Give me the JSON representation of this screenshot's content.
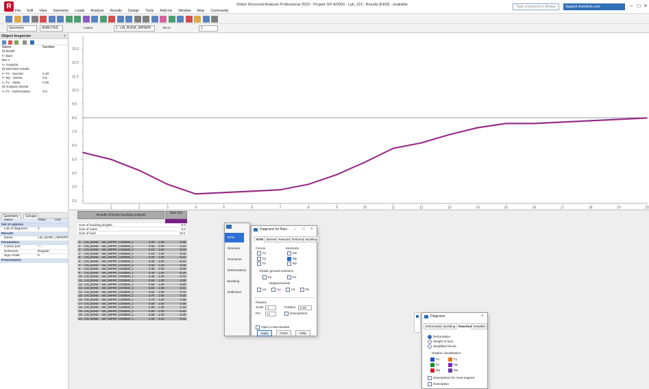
{
  "app": {
    "title": "Robot Structural Analysis Professional 2023 - Projekt: KP-ED500 - Lyk_123 - Results [FEM] - available",
    "logo_letter": "R",
    "search_placeholder": "Type a keyword or phrase",
    "account_label": "Support.Autodesk.com",
    "window_controls": [
      "–",
      "□",
      "×"
    ]
  },
  "menu": [
    "File",
    "Edit",
    "View",
    "Geometry",
    "Loads",
    "Analysis",
    "Results",
    "Design",
    "Tools",
    "Add-Ins",
    "Window",
    "Help",
    "Community"
  ],
  "toolbar": {
    "structure_type_label": "ANALYSIS",
    "layout_select": "Geometry",
    "case_label": "Cases",
    "cases_select": "1: LIN_BUNK_IMPERF",
    "unit_label": "kN·m",
    "extra_select": "1"
  },
  "navigator": {
    "title": "Object Inspector",
    "close_glyph": "×",
    "columns": [
      "Name",
      "Number"
    ],
    "tree": [
      {
        "label": "⊟ Model",
        "value": ""
      },
      {
        "label": "   ⊢ Bars",
        "value": ""
      },
      {
        "label": "      Bar 1",
        "value": ""
      },
      {
        "label": "   ⊢ Analysis",
        "value": ""
      },
      {
        "label": "⊟ Selected results",
        "value": ""
      },
      {
        "label": "   ⊢ Fz - Section",
        "value": "0.40"
      },
      {
        "label": "   ⊢ My - Stress",
        "value": "0.5"
      },
      {
        "label": "   ⊢ Fx - Table",
        "value": "0.00"
      },
      {
        "label": "⊟ Analysis sheets",
        "value": ""
      },
      {
        "label": "   ⊢ Fz - Deformation",
        "value": "0.0"
      }
    ]
  },
  "properties": {
    "tabs": [
      "Geometry",
      "Groups"
    ],
    "columns": [
      "Name",
      "Value",
      "Unit"
    ],
    "groups": [
      {
        "header": "Set of options",
        "rows": [
          {
            "name": "List of diagrams",
            "value": "1"
          }
        ]
      },
      {
        "header": "Results",
        "rows": [
          {
            "name": "Name",
            "value": "LIN_BUNK_IMPERF"
          }
        ]
      },
      {
        "header": "Parameters",
        "rows": [
          {
            "name": "Cursor pos.",
            "value": "—"
          },
          {
            "name": "Extremes",
            "value": "Regular"
          },
          {
            "name": "Sign mode",
            "value": "0"
          }
        ]
      },
      {
        "header": "Presentation",
        "rows": []
      }
    ]
  },
  "chart_data": {
    "type": "line",
    "xlabel": "",
    "ylabel": "",
    "x_ticks": [
      "1",
      "2",
      "3",
      "4",
      "5",
      "6",
      "7",
      "8",
      "9",
      "10",
      "11",
      "12",
      "13",
      "14",
      "15",
      "16",
      "17",
      "18",
      "19",
      "20"
    ],
    "y_ticks": [
      "2.0",
      "3.0",
      "4.0",
      "5.0",
      "6.0",
      "7.0",
      "8.0",
      "9.0",
      "10.0",
      "11.0",
      "12.0",
      "13.0"
    ],
    "xlim": [
      0,
      20
    ],
    "ylim": [
      1.8,
      13.9
    ],
    "reference_line": 8.0,
    "grid": false,
    "series": [
      {
        "x": [
          0,
          1,
          2,
          3,
          4,
          5,
          6,
          7,
          8,
          9,
          10,
          11,
          12,
          13,
          14,
          15,
          16,
          17,
          18,
          19,
          20
        ],
        "values": [
          5.5,
          5.0,
          4.2,
          3.2,
          2.5,
          2.6,
          2.7,
          2.8,
          3.2,
          3.9,
          4.8,
          5.8,
          6.2,
          6.8,
          7.3,
          7.6,
          7.6,
          7.7,
          7.8,
          7.9,
          8.0
        ],
        "color": "#6a2584"
      },
      {
        "x": [
          0,
          1,
          2,
          3,
          4,
          5,
          6,
          7,
          8,
          9,
          10,
          11,
          12,
          13,
          14,
          15,
          16,
          17,
          18,
          19,
          20
        ],
        "values": [
          5.45,
          4.95,
          4.15,
          3.15,
          2.45,
          2.55,
          2.65,
          2.75,
          3.15,
          3.85,
          4.75,
          5.75,
          6.15,
          6.75,
          7.25,
          7.55,
          7.55,
          7.65,
          7.75,
          7.85,
          7.95
        ],
        "color": "#d23a8c"
      }
    ]
  },
  "results_table": {
    "title": "Results of linear buckling analysis",
    "value_header": "Max (m)",
    "accent_color": "#7a1f86",
    "summary": [
      {
        "label": "Sum of buckling lengths",
        "value": "0.0"
      },
      {
        "label": "Sum of mass",
        "value": "0.0"
      },
      {
        "label": "Sum of load",
        "value": "-15.1"
      }
    ],
    "rows": [
      [
        "1",
        "LIN_BUNK",
        "BK_IMPRF_COMBIN_1",
        "0.00",
        "1.00",
        "-2.08"
      ],
      [
        "2",
        "LIN_BUNK",
        "BK_IMPRF_COMBIN_1",
        "0.05",
        "1.00",
        "-4.34"
      ],
      [
        "3",
        "LIN_BUNK",
        "BK_IMPRF_COMBIN_1",
        "0.10",
        "1.00",
        "-5.18"
      ],
      [
        "4",
        "LIN_BUNK",
        "BK_IMPRF_COMBIN_1",
        "0.15",
        "1.00",
        "-6.02"
      ],
      [
        "5",
        "LIN_BUNK",
        "BK_IMPRF_COMBIN_1",
        "0.20",
        "1.00",
        "-6.41"
      ],
      [
        "6",
        "LIN_BUNK",
        "BK_IMPRF_COMBIN_1",
        "0.25",
        "1.00",
        "-6.16"
      ],
      [
        "7",
        "LIN_BUNK",
        "BK_IMPRF_COMBIN_1",
        "0.30",
        "1.00",
        "-5.95"
      ],
      [
        "8",
        "LIN_BUNK",
        "BK_IMPRF_COMBIN_1",
        "0.35",
        "1.00",
        "-5.69"
      ],
      [
        "9",
        "LIN_BUNK",
        "BK_IMPRF_COMBIN_1",
        "0.40",
        "1.00",
        "-5.18"
      ],
      [
        "10",
        "LIN_BUNK",
        "BK_IMPRF_COMBIN_1",
        "0.45",
        "1.00",
        "-4.72"
      ],
      [
        "11",
        "LIN_BUNK",
        "BK_IMPRF_COMBIN_1",
        "0.50",
        "1.00",
        "-4.46"
      ],
      [
        "12",
        "LIN_BUNK",
        "BK_IMPRF_COMBIN_1",
        "0.55",
        "1.00",
        "-3.88"
      ],
      [
        "13",
        "LIN_BUNK",
        "BK_IMPRF_COMBIN_1",
        "0.60",
        "1.00",
        "-3.21"
      ],
      [
        "14",
        "LIN_BUNK",
        "BK_IMPRF_COMBIN_1",
        "0.65",
        "1.00",
        "-2.75"
      ],
      [
        "15",
        "LIN_BUNK",
        "BK_IMPRF_COMBIN_1",
        "0.70",
        "1.00",
        "-2.40"
      ],
      [
        "16",
        "LIN_BUNK",
        "BK_IMPRF_COMBIN_1",
        "0.75",
        "1.00",
        "-1.96"
      ],
      [
        "17",
        "LIN_BUNK",
        "BK_IMPRF_COMBIN_1",
        "0.80",
        "1.00",
        "-1.55"
      ],
      [
        "18",
        "LIN_BUNK",
        "BK_IMPRF_COMBIN_1",
        "0.85",
        "1.00",
        "-1.10"
      ],
      [
        "19",
        "LIN_BUNK",
        "BK_IMPRF_COMBIN_1",
        "0.90",
        "1.00",
        "-0.62"
      ],
      [
        "20",
        "LIN_BUNK",
        "BK_IMPRF_COMBIN_1",
        "0.95",
        "1.00",
        "-0.28"
      ],
      [
        "21",
        "LIN_BUNK",
        "BK_IMPRF_COMBIN_1",
        "1.00",
        "1.00",
        "-0.04"
      ]
    ]
  },
  "diagram_dialog": {
    "title": "Diagrams for Bars",
    "side_items": [
      "NTM",
      "Stresses",
      "Reactions",
      "Deformations",
      "Buckling",
      "Deflection"
    ],
    "tabs": [
      "NTM",
      "Stresses",
      "Reactions",
      "Deformations",
      "Buckling"
    ],
    "forces_label": "Forces",
    "moments_label": "Moments",
    "force_options": [
      "Fx",
      "Fy",
      "Fz"
    ],
    "moment_options": [
      "Mx",
      "My",
      "Mz"
    ],
    "elastic_label": "Elastic ground reactions",
    "elastic_options": [
      "Ky",
      "Kz"
    ],
    "displacements_label": "Displacements",
    "disp_options": [
      "Ux",
      "Uy",
      "Uz",
      "Rx"
    ],
    "params_label": "Params",
    "scale_label": "Scale",
    "scale_value": "1",
    "per_label": "Per",
    "per_value": "m",
    "position_label": "Position",
    "position_value": "0.00",
    "label_option": "Descriptions",
    "apply_label": "Apply",
    "close_label": "Close",
    "help_label": "Help",
    "note": "Open a new window"
  },
  "side_dialog": {
    "title": "Diagrams",
    "tabs": [
      "Deformations",
      "Buckling",
      "Reactions",
      "Detailed"
    ],
    "options": [
      "Deformation",
      "Weight of bars",
      "Simplified forces"
    ],
    "section_label": "Graphic visualisation",
    "colors": [
      "#1f4fbf",
      "#e07a1d",
      "#1a8f2e",
      "#7b2cbf",
      "#cc1f2a",
      "#6a3fa0"
    ],
    "color_labels": [
      "Fx",
      "Fy",
      "Fz",
      "Mx",
      "My",
      "Mz"
    ],
    "option_bottom": "Descriptions for more support",
    "option_last": "Description"
  }
}
